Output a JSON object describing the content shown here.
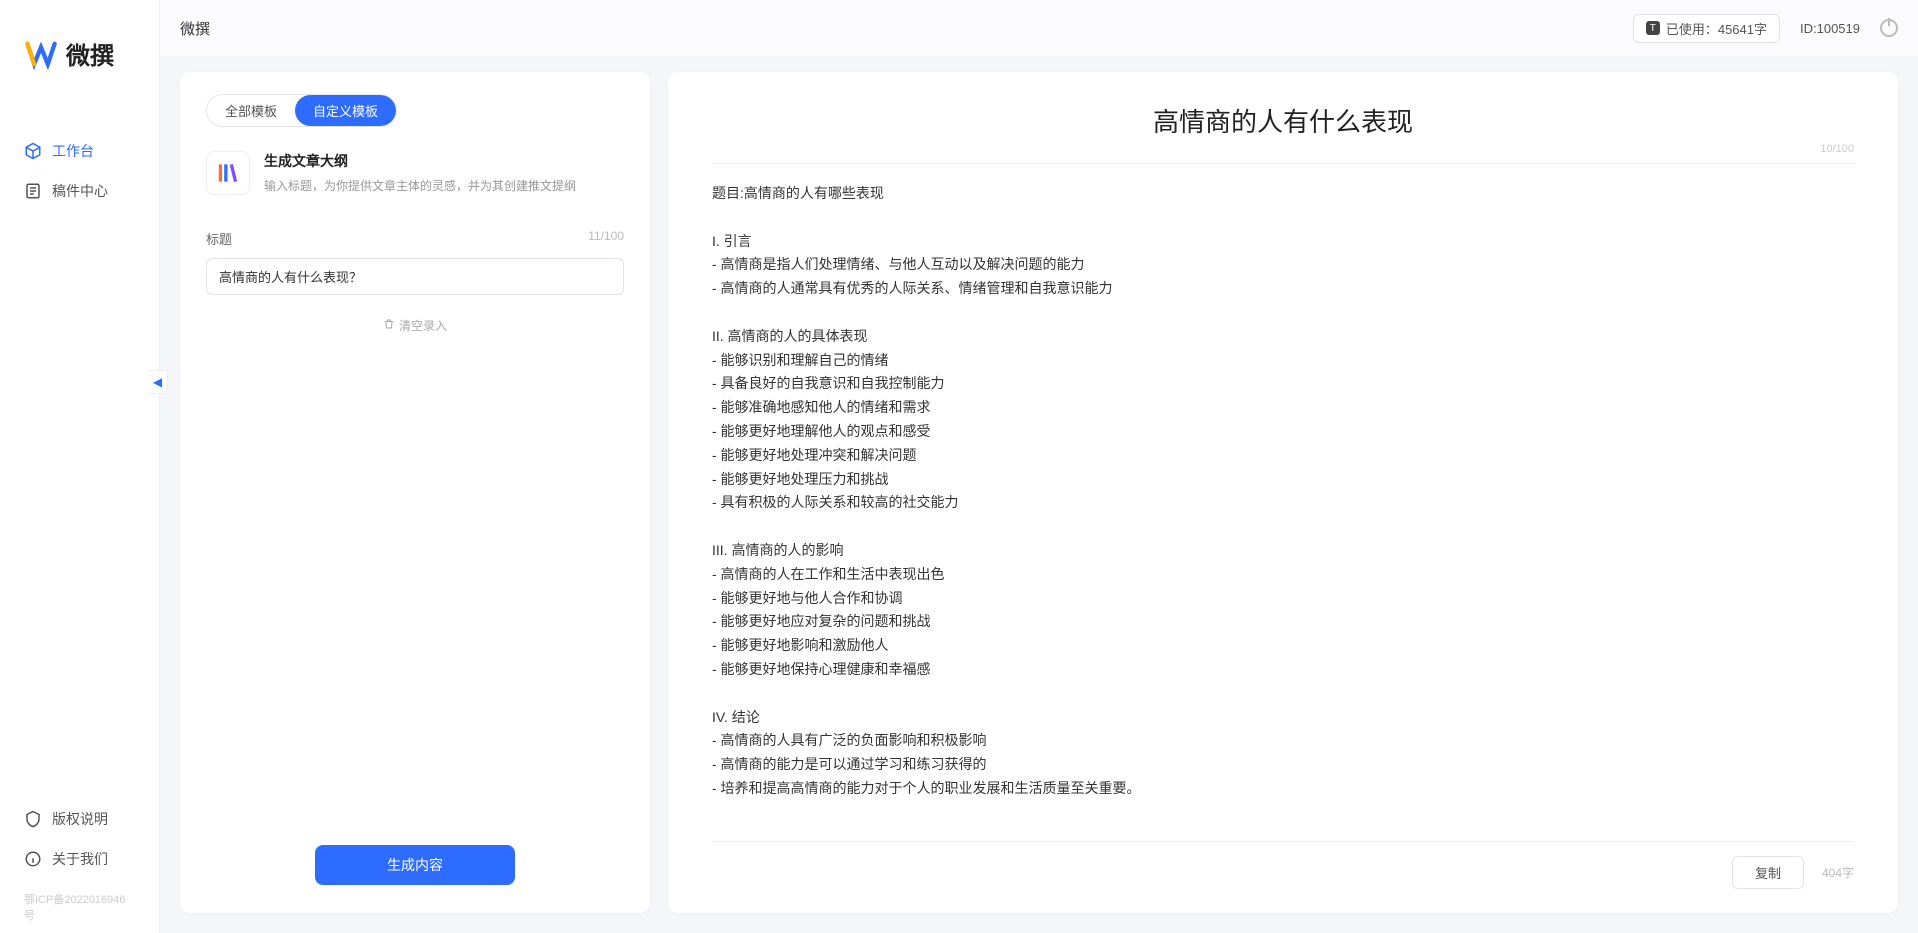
{
  "brand": "微撰",
  "topbar": {
    "title": "微撰",
    "usage": "已使用：45641字",
    "id": "ID:100519"
  },
  "sidebar": {
    "items": [
      {
        "label": "工作台",
        "active": true
      },
      {
        "label": "稿件中心",
        "active": false
      }
    ],
    "bottom": [
      {
        "label": "版权说明"
      },
      {
        "label": "关于我们"
      }
    ],
    "icp": "鄂ICP备2022016946号"
  },
  "leftPanel": {
    "tabs": [
      {
        "label": "全部模板",
        "active": false
      },
      {
        "label": "自定义模板",
        "active": true
      }
    ],
    "template": {
      "title": "生成文章大纲",
      "desc": "输入标题，为你提供文章主体的灵感，并为其创建推文提纲"
    },
    "field": {
      "label": "标题",
      "count": "11/100",
      "value": "高情商的人有什么表现？"
    },
    "clear": "清空录入",
    "generate": "生成内容"
  },
  "doc": {
    "title": "高情商的人有什么表现",
    "subcount": "10/100",
    "body": "题目:高情商的人有哪些表现\n\nI. 引言\n- 高情商是指人们处理情绪、与他人互动以及解决问题的能力\n- 高情商的人通常具有优秀的人际关系、情绪管理和自我意识能力\n\nII. 高情商的人的具体表现\n- 能够识别和理解自己的情绪\n- 具备良好的自我意识和自我控制能力\n- 能够准确地感知他人的情绪和需求\n- 能够更好地理解他人的观点和感受\n- 能够更好地处理冲突和解决问题\n- 能够更好地处理压力和挑战\n- 具有积极的人际关系和较高的社交能力\n\nIII. 高情商的人的影响\n- 高情商的人在工作和生活中表现出色\n- 能够更好地与他人合作和协调\n- 能够更好地应对复杂的问题和挑战\n- 能够更好地影响和激励他人\n- 能够更好地保持心理健康和幸福感\n\nIV. 结论\n- 高情商的人具有广泛的负面影响和积极影响\n- 高情商的能力是可以通过学习和练习获得的\n- 培养和提高高情商的能力对于个人的职业发展和生活质量至关重要。",
    "copy": "复制",
    "wordcount": "404字"
  }
}
